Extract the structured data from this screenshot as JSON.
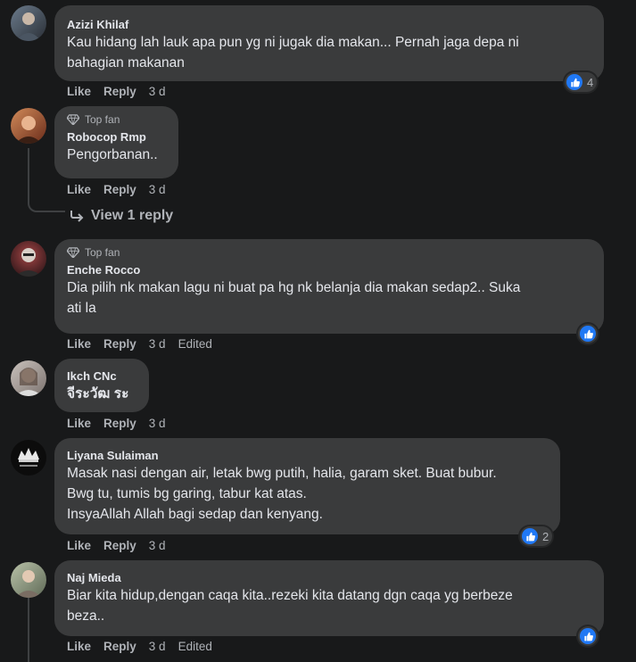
{
  "colors": {
    "background": "#18191a",
    "bubble": "#3a3b3c",
    "like_blue": "#2078f4",
    "muted": "#b0b3b8",
    "text": "#e4e6eb"
  },
  "actions": {
    "like": "Like",
    "reply": "Reply",
    "edited": "Edited"
  },
  "comments": [
    {
      "author": "Azizi Khilaf",
      "badge": "",
      "lines": [
        "Kau hidang lah lauk apa pun yg ni jugak dia makan... Pernah jaga depa ni",
        "bahagian makanan"
      ],
      "time": "3 d",
      "edited": false,
      "reactions": "4"
    },
    {
      "author": "Robocop Rmp",
      "badge": "Top fan",
      "lines": [
        "Pengorbanan.."
      ],
      "time": "3 d",
      "edited": false,
      "reactions": ""
    },
    {
      "author": "Enche Rocco",
      "badge": "Top fan",
      "lines": [
        "Dia pilih nk makan lagu ni buat pa hg nk belanja dia makan sedap2.. Suka",
        "ati la"
      ],
      "time": "3 d",
      "edited": true,
      "reactions": ""
    },
    {
      "author": "Ikch CNc",
      "badge": "",
      "lines": [
        "จีระวัฒ ระ"
      ],
      "time": "3 d",
      "edited": false,
      "reactions": ""
    },
    {
      "author": "Liyana Sulaiman",
      "badge": "",
      "lines": [
        "Masak nasi dengan air, letak bwg putih, halia, garam sket. Buat bubur.",
        "Bwg tu, tumis bg garing, tabur kat atas.",
        "InsyaAllah Allah bagi sedap dan kenyang."
      ],
      "time": "3 d",
      "edited": false,
      "reactions": "2"
    },
    {
      "author": "Naj Mieda",
      "badge": "",
      "lines": [
        "Biar kita hidup,dengan caqa kita..rezeki kita datang dgn caqa yg berbeze",
        "beza.."
      ],
      "time": "3 d",
      "edited": true,
      "reactions": ""
    }
  ],
  "view_reply": "View 1 reply",
  "icons": {
    "like": "thumbs-up-icon",
    "badge": "diamond-icon",
    "reply_arrow": "reply-arrow-icon"
  }
}
